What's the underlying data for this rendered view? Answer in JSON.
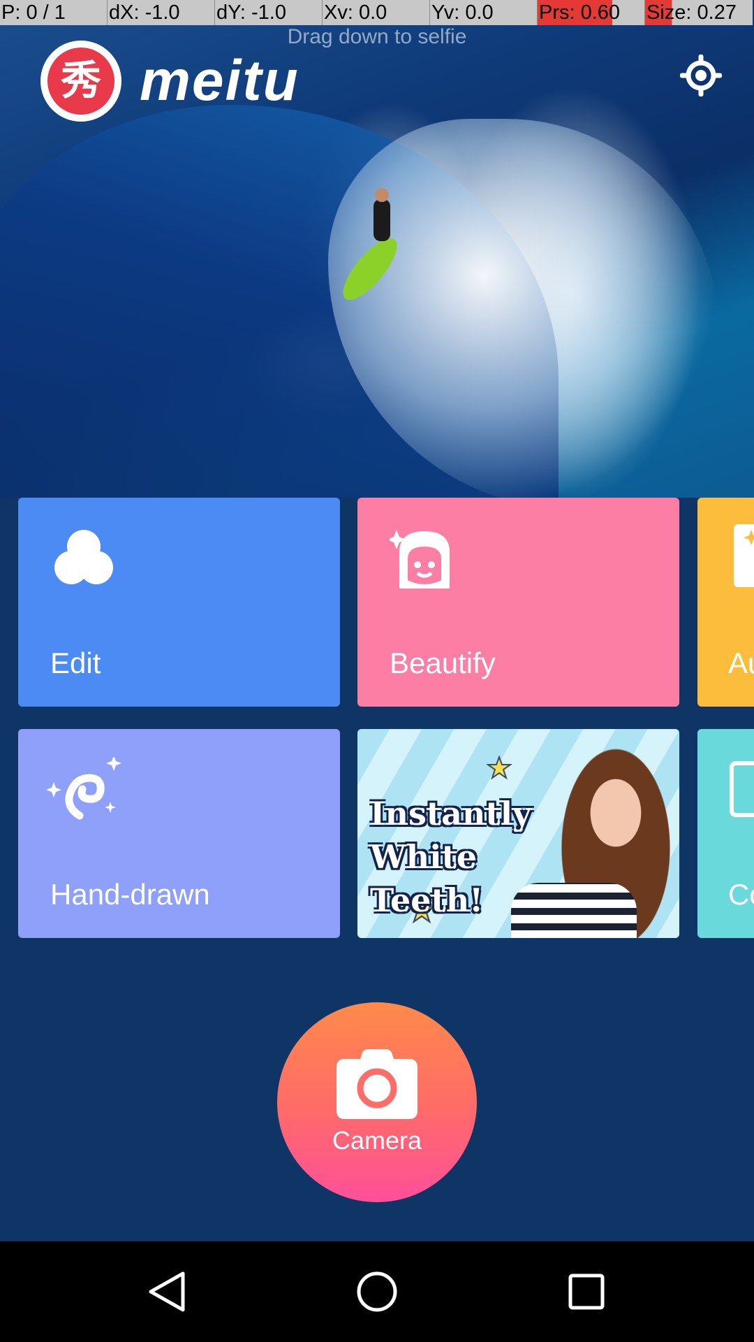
{
  "debug_bar": {
    "pointer": "P: 0 / 1",
    "dx": "dX: -1.0",
    "dy": "dY: -1.0",
    "xv": "Xv: 0.0",
    "yv": "Yv: 0.0",
    "prs": "Prs: 0.60",
    "size": "Size: 0.27"
  },
  "header": {
    "drag_hint": "Drag down to selfie",
    "logo_char": "秀",
    "wordmark": "meitu",
    "settings_icon": "settings-gear-icon"
  },
  "tiles": {
    "edit": {
      "label": "Edit",
      "icon": "three-circles-icon",
      "color": "#4c8bf4"
    },
    "beautify": {
      "label": "Beautify",
      "icon": "face-sparkle-icon",
      "color": "#fc7ea4"
    },
    "auto": {
      "label": "Au",
      "icon": "document-sparkle-icon",
      "color": "#fdbd3c"
    },
    "hand_drawn": {
      "label": "Hand-drawn",
      "icon": "hand-drawn-swirl-icon",
      "color": "#8fa0fb"
    },
    "promo": {
      "text": "Instantly\nWhite Teeth!"
    },
    "collage": {
      "label": "Co",
      "icon": "collage-frame-icon",
      "color": "#6ad9dc"
    }
  },
  "camera": {
    "label": "Camera",
    "icon": "camera-icon"
  },
  "navbar": {
    "back_icon": "back-triangle-icon",
    "home_icon": "home-circle-icon",
    "recents_icon": "recents-square-icon"
  }
}
